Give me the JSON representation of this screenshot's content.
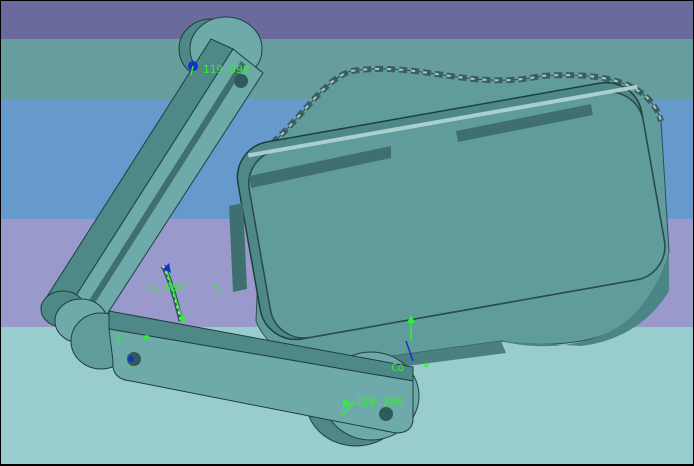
{
  "viewport": {
    "background_bands": [
      "#6a6a9c",
      "#679d9d",
      "#6699cc",
      "#9999cc",
      "#99cccc"
    ]
  },
  "colors": {
    "body": "#5f9c9b",
    "body_dark": "#3f6f6e",
    "body_light": "#86bcbb",
    "annotation": "#33ee33",
    "constraint_marker": "#1133cc"
  },
  "annotations": {
    "top_angle": "119.990",
    "mid_angle": "71.980°",
    "mid_suffix": "3",
    "bottom_angle": "118.980",
    "coincident_left": "C",
    "coincident_left_mark": "+",
    "coincident_right": "Co",
    "coincident_right_mark": "*"
  }
}
